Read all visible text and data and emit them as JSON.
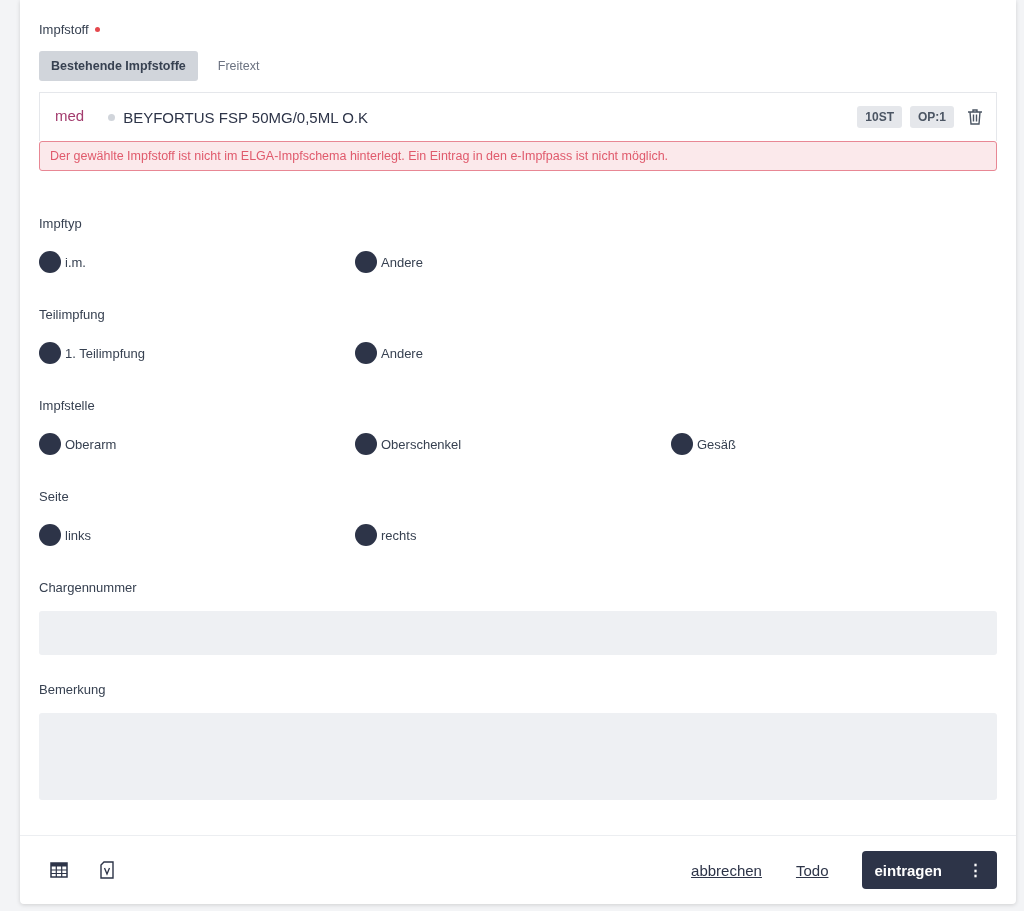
{
  "vaccine": {
    "label": "Impfstoff",
    "required": true,
    "tabs": [
      {
        "label": "Bestehende Impfstoffe",
        "selected": true
      },
      {
        "label": "Freitext",
        "selected": false
      }
    ],
    "item": {
      "tag": "med",
      "name": "BEYFORTUS FSP 50MG/0,5ML O.K",
      "badges": [
        "10ST",
        "OP:1"
      ]
    },
    "error": "Der gewählte Impfstoff ist nicht im ELGA-Impfschema hinterlegt. Ein Eintrag in den e-Impfpass ist nicht möglich."
  },
  "groups": [
    {
      "label": "Impftyp",
      "options": [
        {
          "label": "i.m.",
          "selected": false
        },
        {
          "label": "Andere",
          "selected": false
        }
      ]
    },
    {
      "label": "Teilimpfung",
      "options": [
        {
          "label": "1. Teilimpfung",
          "selected": false
        },
        {
          "label": "Andere",
          "selected": false
        }
      ]
    },
    {
      "label": "Impfstelle",
      "options": [
        {
          "label": "Oberarm",
          "selected": false
        },
        {
          "label": "Oberschenkel",
          "selected": false
        },
        {
          "label": "Gesäß",
          "selected": false
        }
      ]
    },
    {
      "label": "Seite",
      "options": [
        {
          "label": "links",
          "selected": false
        },
        {
          "label": "rechts",
          "selected": false
        }
      ]
    }
  ],
  "fields": [
    {
      "label": "Chargennummer",
      "kind": "input"
    },
    {
      "label": "Bemerkung",
      "kind": "textarea"
    }
  ],
  "footer": {
    "links": [
      "abbrechen",
      "Todo"
    ],
    "primary": "eintragen",
    "menu": "⋮"
  }
}
